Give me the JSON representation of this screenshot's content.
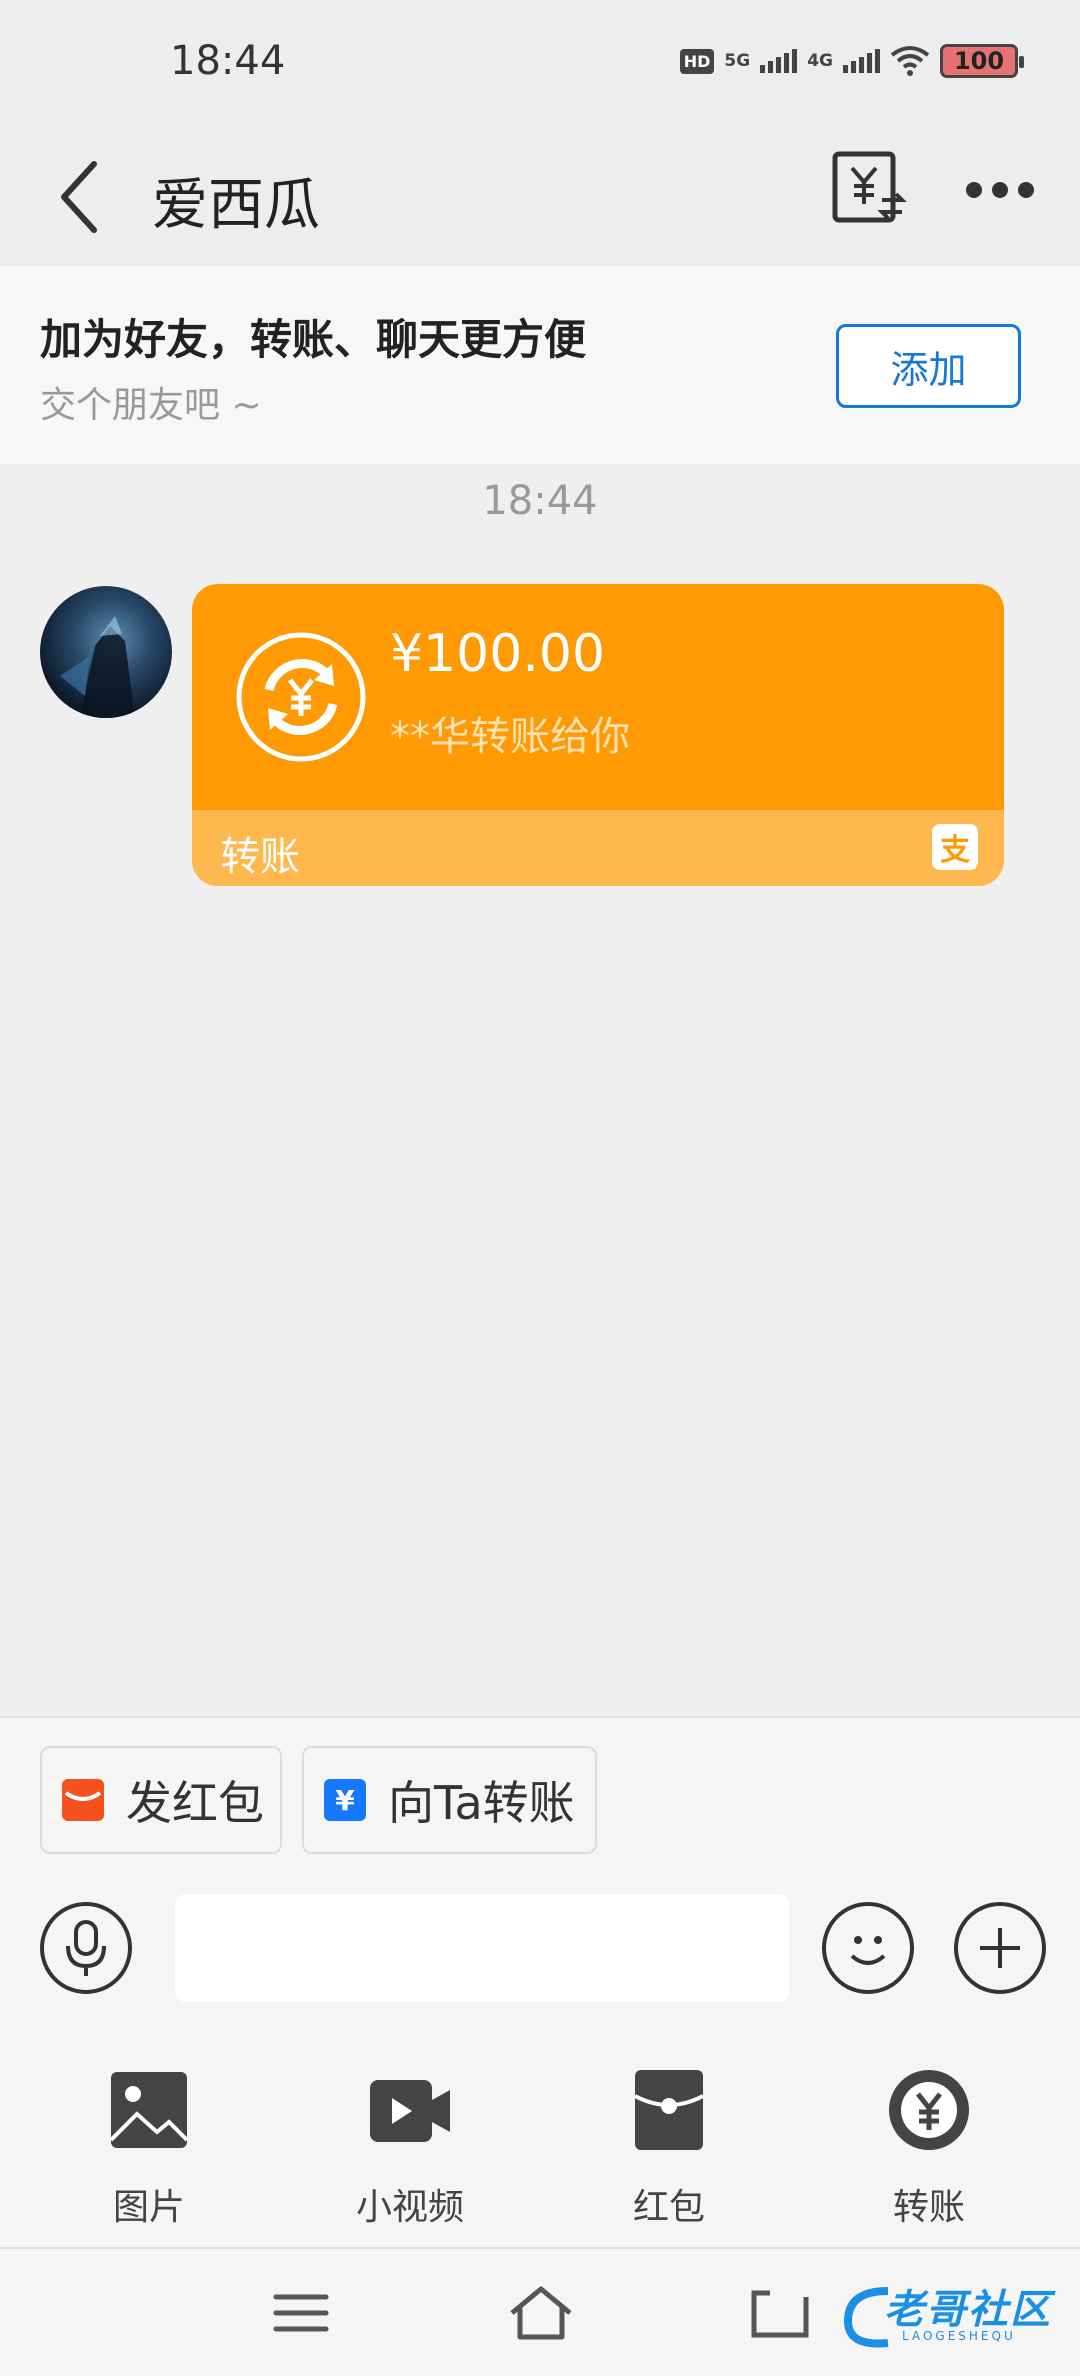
{
  "status_bar": {
    "time": "18:44",
    "hd": "HD",
    "sim1": "5G",
    "sim2": "4G",
    "battery": "100"
  },
  "nav": {
    "title": "爱西瓜"
  },
  "friend_bar": {
    "title": "加为好友，转账、聊天更方便",
    "subtitle": "交个朋友吧 ~",
    "add_label": "添加"
  },
  "chat": {
    "timestamp": "18:44"
  },
  "transfer_card": {
    "amount": "¥100.00",
    "description": "**华转账给你",
    "label": "转账",
    "accent_color": "#ff9a05"
  },
  "quick_actions": {
    "red_packet": "发红包",
    "transfer": "向Ta转账"
  },
  "input": {
    "placeholder": "",
    "value": ""
  },
  "tools": [
    {
      "label": "图片",
      "icon": "image-icon"
    },
    {
      "label": "小视频",
      "icon": "video-icon"
    },
    {
      "label": "红包",
      "icon": "red-packet-icon"
    },
    {
      "label": "转账",
      "icon": "transfer-icon"
    }
  ],
  "watermark": {
    "text": "老哥社区",
    "sub": "LAOGESHEQU"
  }
}
